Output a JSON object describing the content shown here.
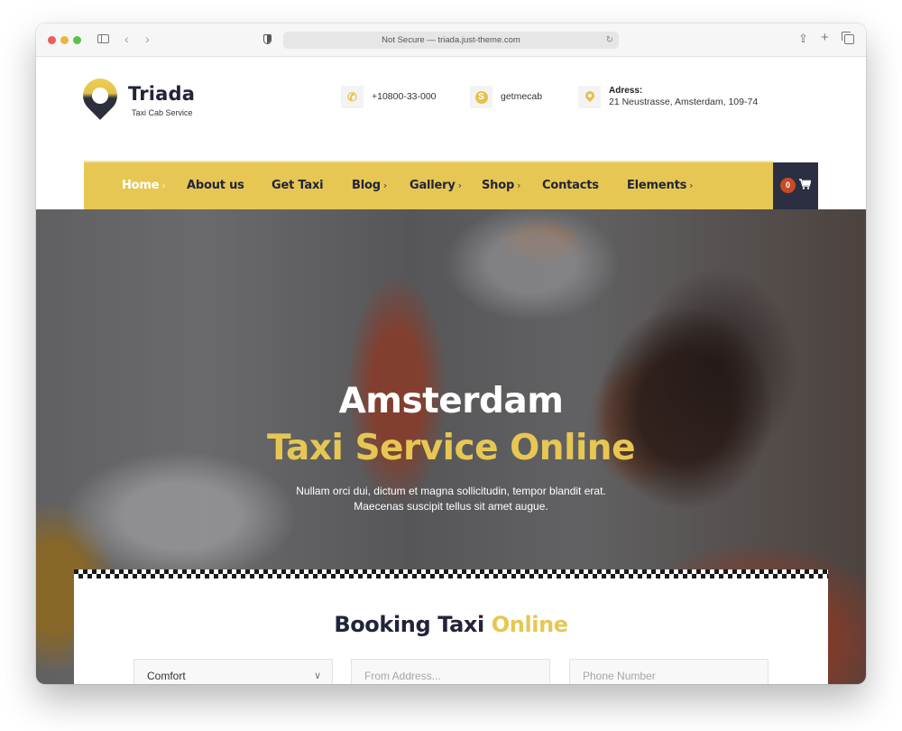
{
  "browser": {
    "url_text": "Not Secure — triada.just-theme.com",
    "nav_back": "‹",
    "nav_forward": "›",
    "reload_icon": "↻",
    "share_icon": "⇪",
    "new_tab_icon": "+"
  },
  "brand": {
    "name": "Triada",
    "tagline": "Taxi Cab Service",
    "accent": "#e6c753",
    "dark": "#22243a"
  },
  "contacts": {
    "phone": {
      "icon": "phone-icon",
      "glyph": "✆",
      "text": "+10800-33-000"
    },
    "skype": {
      "icon": "skype-icon",
      "glyph": "S",
      "text": "getmecab"
    },
    "address": {
      "icon": "location-pin-icon",
      "label": "Adress:",
      "text": "21 Neustrasse, Amsterdam, 109-74"
    }
  },
  "nav": {
    "items": [
      {
        "label": "Home",
        "chevron": "›",
        "active": true
      },
      {
        "label": "About us",
        "chevron": ""
      },
      {
        "label": "Get Taxi",
        "chevron": ""
      },
      {
        "label": "Blog",
        "chevron": "›"
      },
      {
        "label": "Gallery",
        "chevron": "›"
      },
      {
        "label": "Shop",
        "chevron": "›"
      },
      {
        "label": "Contacts",
        "chevron": ""
      },
      {
        "label": "Elements",
        "chevron": "›"
      }
    ],
    "cart_count": "0"
  },
  "hero": {
    "title_line1": "Amsterdam",
    "title_line2": "Taxi Service Online",
    "subtitle_line1": "Nullam orci dui, dictum et magna sollicitudin, tempor blandit erat.",
    "subtitle_line2": "Maecenas suscipit tellus sit amet augue."
  },
  "booking": {
    "title_main": "Booking Taxi",
    "title_highlight": "Online",
    "car_class_value": "Comfort",
    "from_address_placeholder": "From Address...",
    "phone_placeholder": "Phone Number"
  }
}
